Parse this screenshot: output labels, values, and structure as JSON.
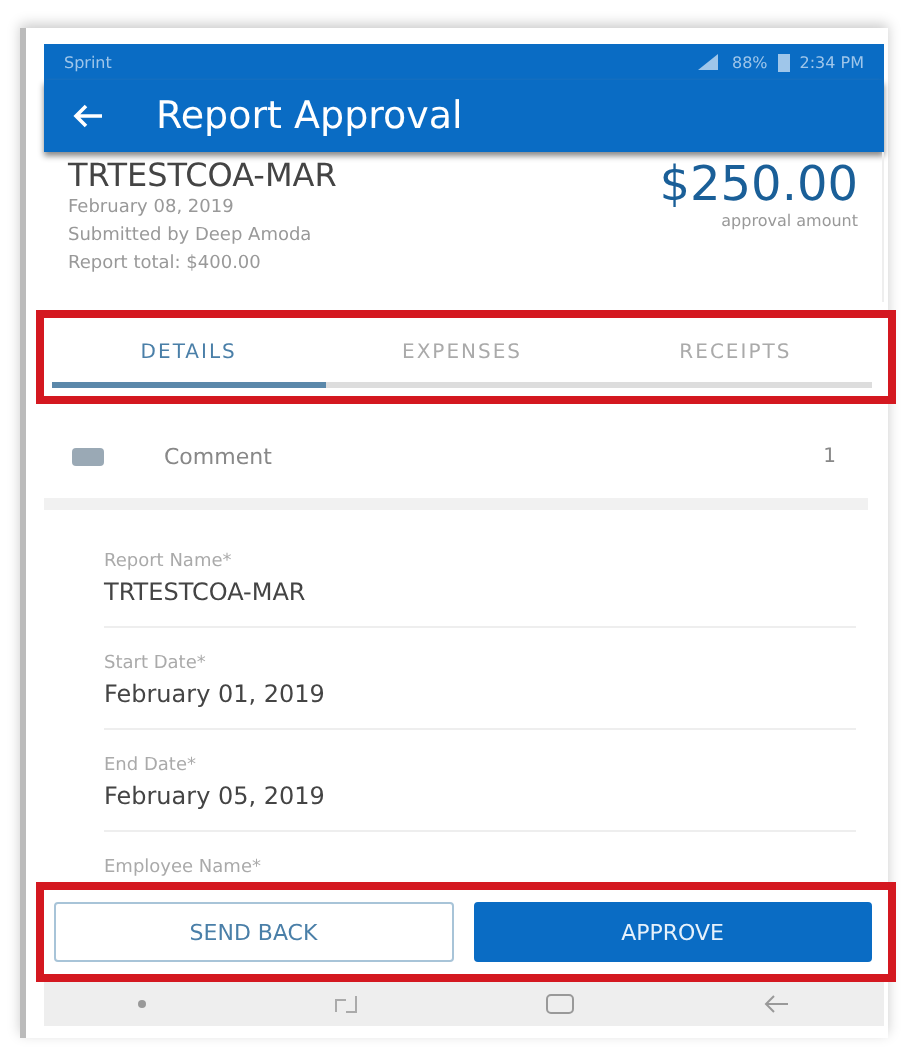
{
  "status_bar": {
    "carrier": "Sprint",
    "battery": "88%",
    "time": "2:34 PM"
  },
  "app_bar": {
    "title": "Report Approval"
  },
  "report": {
    "name": "TRTESTCOA-MAR",
    "date": "February 08, 2019",
    "submitted_by": "Submitted by Deep Amoda",
    "total": "Report total: $400.00",
    "amount": "$250.00",
    "amount_label": "approval amount"
  },
  "tabs": [
    {
      "label": "DETAILS",
      "selected": true
    },
    {
      "label": "EXPENSES",
      "selected": false
    },
    {
      "label": "RECEIPTS",
      "selected": false
    }
  ],
  "comment": {
    "label": "Comment",
    "count": "1"
  },
  "fields": [
    {
      "label": "Report Name*",
      "value": "TRTESTCOA-MAR"
    },
    {
      "label": "Start Date*",
      "value": "February 01, 2019"
    },
    {
      "label": "End Date*",
      "value": "February 05, 2019"
    },
    {
      "label": "Employee Name*"
    }
  ],
  "buttons": [
    {
      "label": "SEND BACK",
      "kind": "outline"
    },
    {
      "label": "APPROVE",
      "kind": "primary"
    }
  ]
}
